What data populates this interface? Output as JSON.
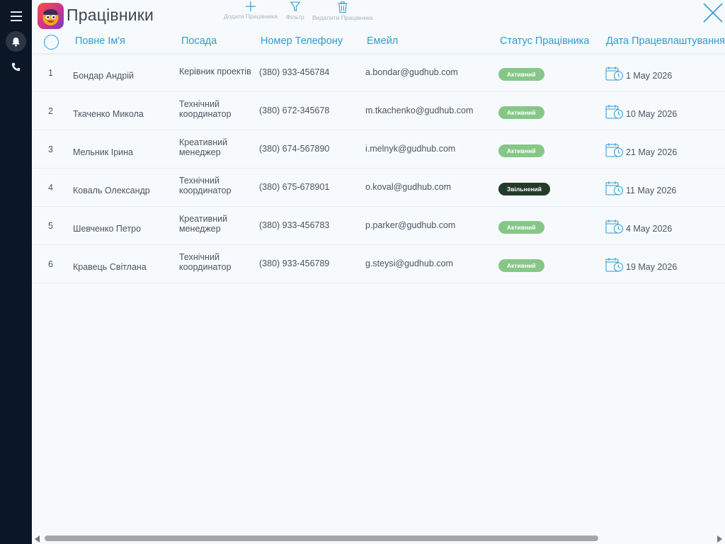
{
  "app": {
    "title": "Працівники"
  },
  "toolbar": {
    "add_label": "Додати Працівника",
    "filter_label": "Фільтр",
    "delete_label": "Видалити Працівника"
  },
  "sidebar": {
    "icons": [
      "menu-icon",
      "bell-icon",
      "phone-icon"
    ]
  },
  "table": {
    "headers": {
      "name": "Повне Ім'я",
      "position": "Посада",
      "phone": "Номер Телефону",
      "email": "Емейл",
      "status": "Статус Працівника",
      "date": "Дата Працевлаштування"
    },
    "rows": [
      {
        "num": "1",
        "name": "Бондар Андрій",
        "position": "Керівник проектів",
        "phone": "(380) 933-456784",
        "email": "a.bondar@gudhub.com",
        "status": "Активний",
        "date": "1 May 2026"
      },
      {
        "num": "2",
        "name": "Ткаченко Микола",
        "position": "Технічний координатор",
        "phone": "(380) 672-345678",
        "email": "m.tkachenko@gudhub.com",
        "status": "Активний",
        "date": "10 May 2026"
      },
      {
        "num": "3",
        "name": "Мельник Ірина",
        "position": "Креативний менеджер",
        "phone": "(380) 674-567890",
        "email": "i.melnyk@gudhub.com",
        "status": "Активний",
        "date": "21 May 2026"
      },
      {
        "num": "4",
        "name": "Коваль Олександр",
        "position": "Технічний координатор",
        "phone": "(380) 675-678901",
        "email": "o.koval@gudhub.com",
        "status": "Звільнений",
        "date": "11 May 2026"
      },
      {
        "num": "5",
        "name": "Шевченко Петро",
        "position": "Креативний менеджер",
        "phone": "(380) 933-456783",
        "email": "p.parker@gudhub.com",
        "status": "Активний",
        "date": "4 May 2026"
      },
      {
        "num": "6",
        "name": "Кравець Світлана",
        "position": "Технічний координатор",
        "phone": "(380) 933-456789",
        "email": "g.steysi@gudhub.com",
        "status": "Активний",
        "date": "19 May 2026"
      }
    ]
  },
  "colors": {
    "accent": "#2d9bd2",
    "sidebar_bg": "#0b1626",
    "status_active": "#86c788",
    "status_fired": "#243b2c",
    "background": "#f7fafc"
  }
}
